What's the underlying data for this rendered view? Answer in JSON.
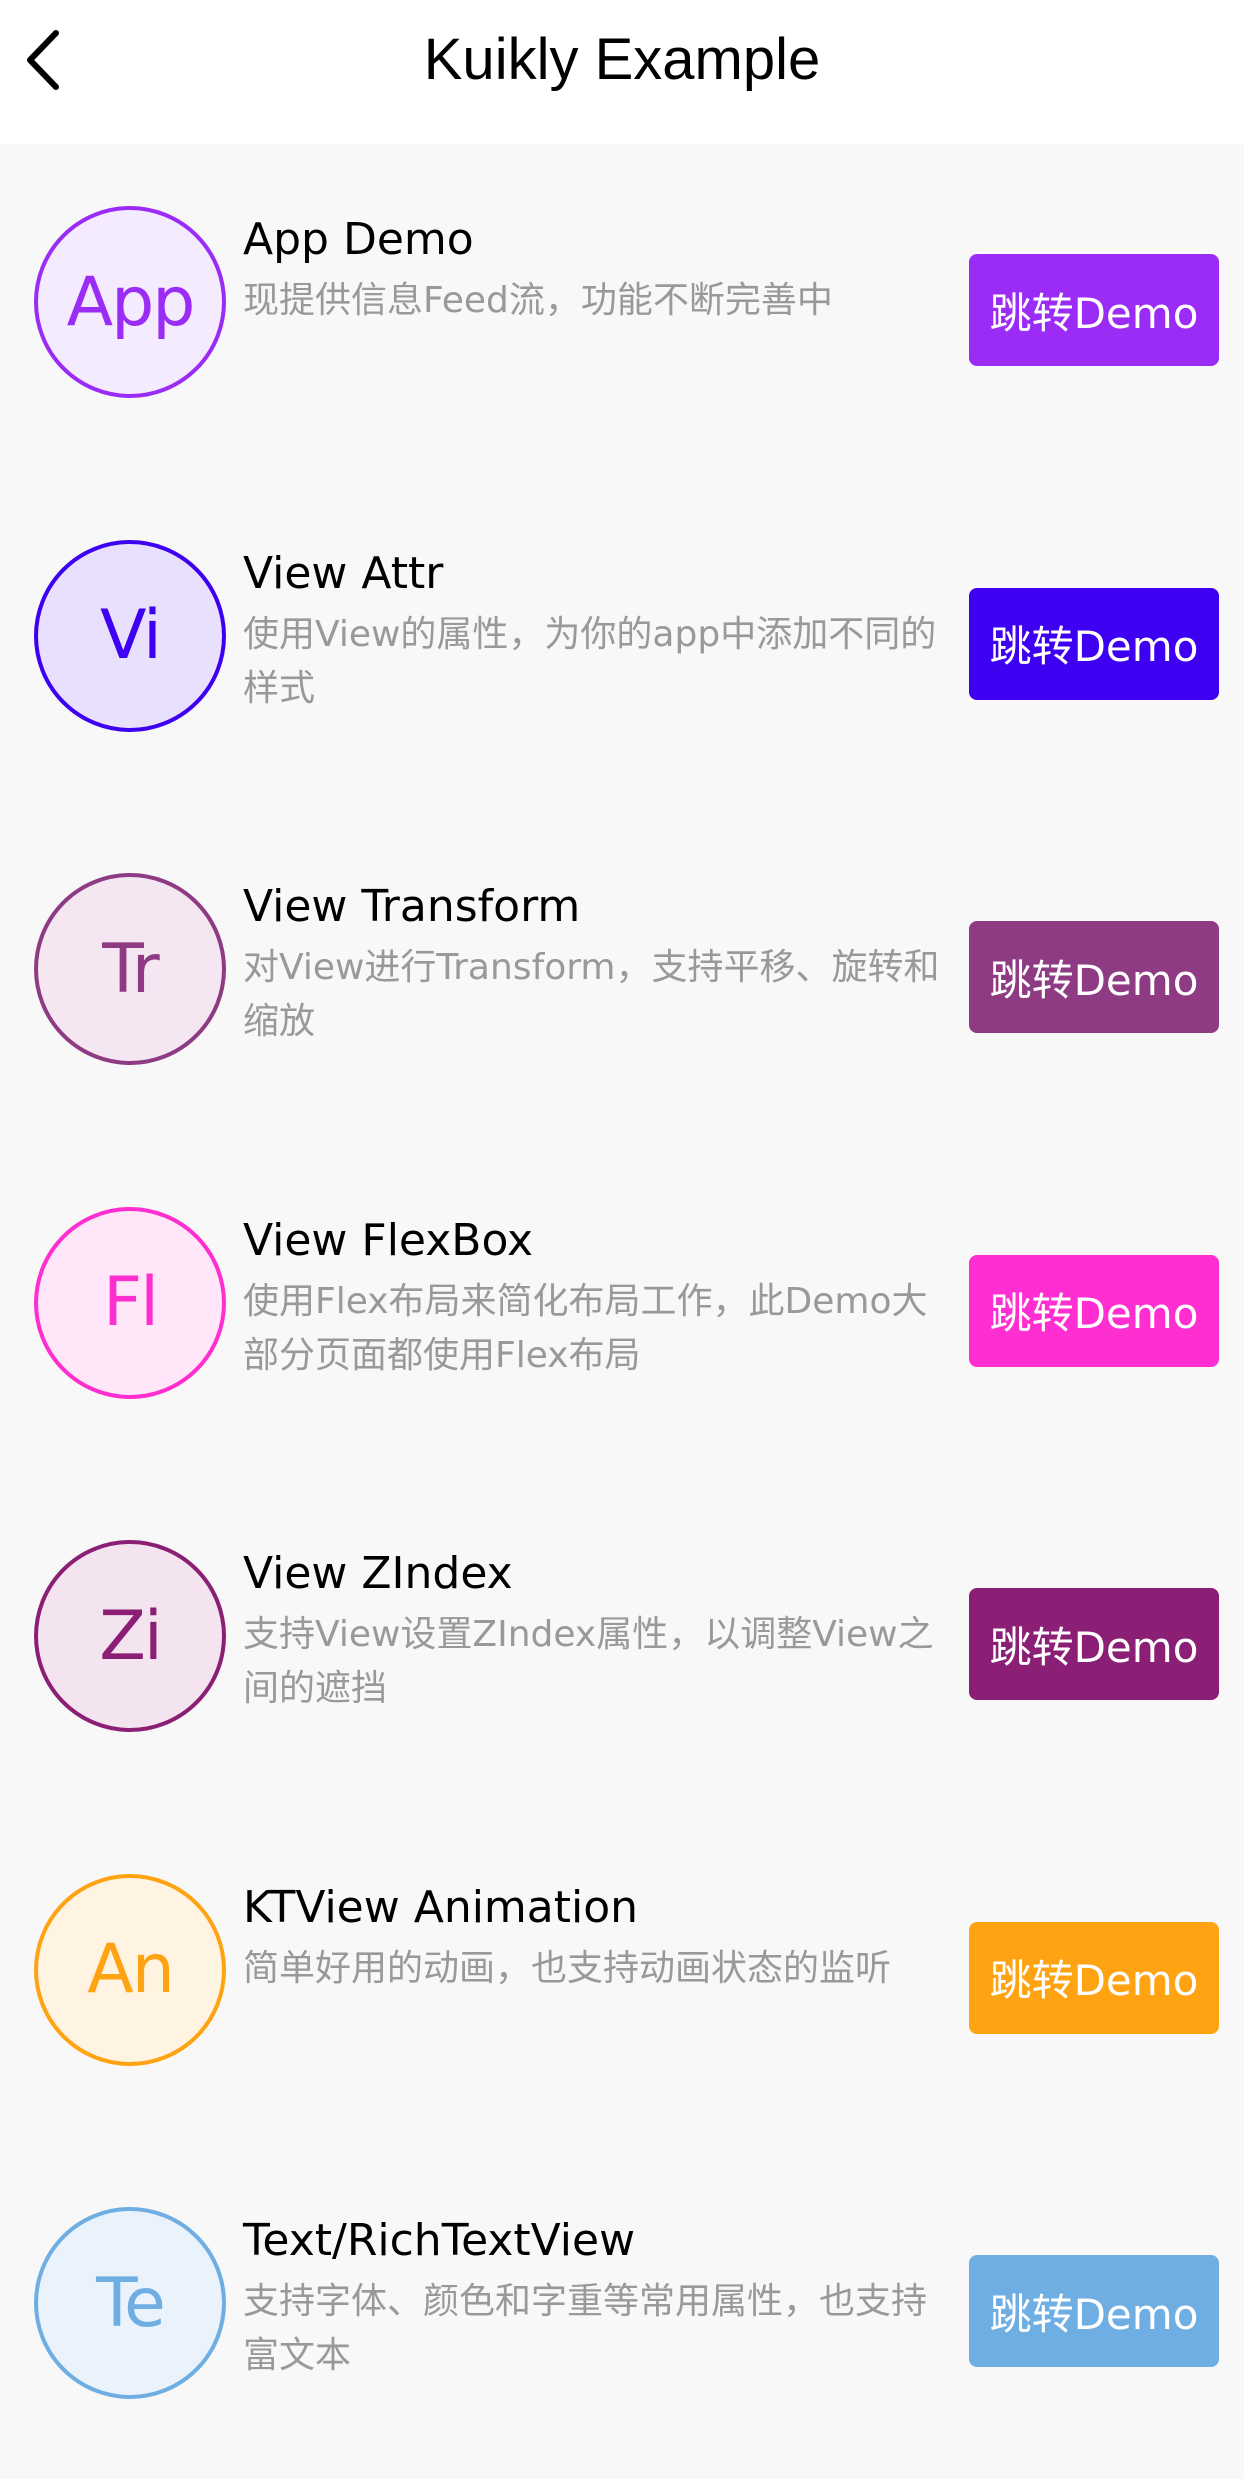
{
  "header": {
    "title": "Kuikly Example"
  },
  "items": [
    {
      "abbr": "App",
      "title": "App Demo",
      "desc": "现提供信息Feed流，功能不断完善中",
      "button": "跳转Demo",
      "color": "#9A2CF5",
      "tint": "#F5EBFE"
    },
    {
      "abbr": "Vi",
      "title": "View Attr",
      "desc": "使用View的属性，为你的app中添加不同的样式",
      "button": "跳转Demo",
      "color": "#3D00F0",
      "tint": "#E8E0FD"
    },
    {
      "abbr": "Tr",
      "title": "View Transform",
      "desc": "对View进行Transform，支持平移、旋转和缩放",
      "button": "跳转Demo",
      "color": "#8E3B84",
      "tint": "#F4E7F2"
    },
    {
      "abbr": "Fl",
      "title": "View FlexBox",
      "desc": "使用Flex布局来简化布局工作，此Demo大部分页面都使用Flex布局",
      "button": "跳转Demo",
      "color": "#FF2ED0",
      "tint": "#FFE6F9"
    },
    {
      "abbr": "Zi",
      "title": "View ZIndex",
      "desc": "支持View设置ZIndex属性，以调整View之间的遮挡",
      "button": "跳转Demo",
      "color": "#8B1F76",
      "tint": "#F4E4EF"
    },
    {
      "abbr": "An",
      "title": "KTView Animation",
      "desc": "简单好用的动画，也支持动画状态的监听",
      "button": "跳转Demo",
      "color": "#FFA312",
      "tint": "#FFF3E2"
    },
    {
      "abbr": "Te",
      "title": "Text/RichTextView",
      "desc": "支持字体、颜色和字重等常用属性，也支持富文本",
      "button": "跳转Demo",
      "color": "#6FAEE3",
      "tint": "#EAF3FC"
    }
  ]
}
